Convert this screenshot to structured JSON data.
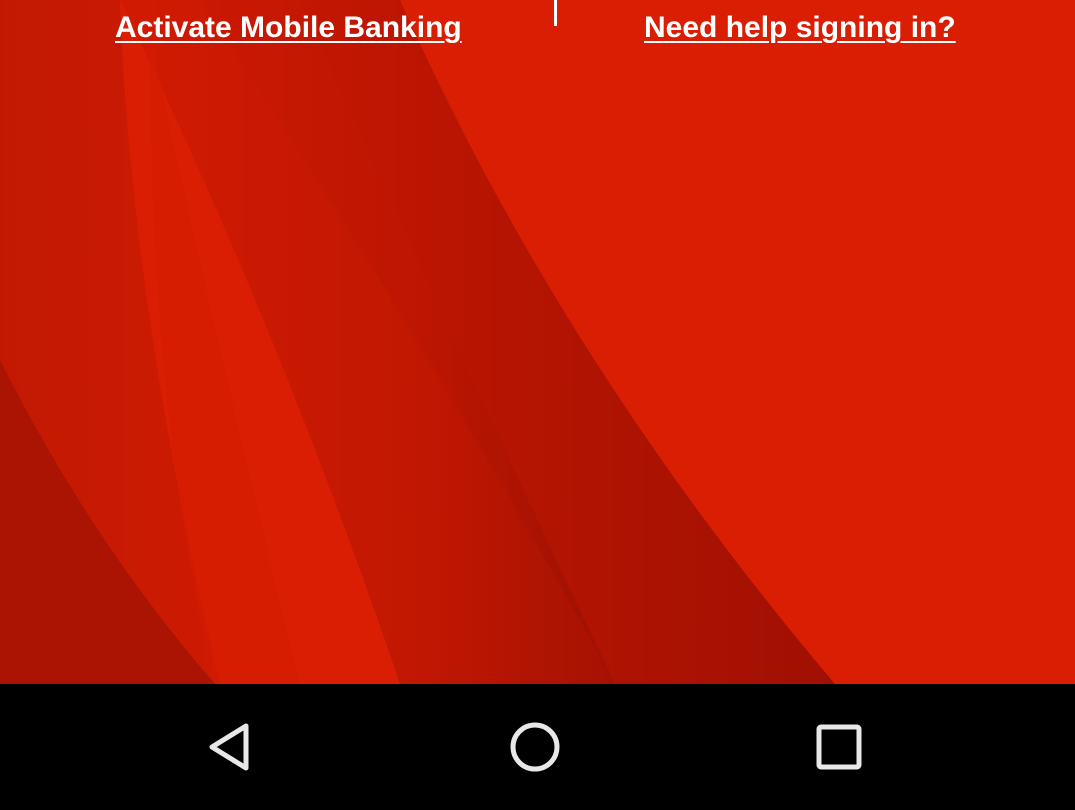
{
  "screen": {
    "links": {
      "activate_label": "Activate Mobile Banking",
      "help_label": "Need help signing in?"
    },
    "colors": {
      "background_red": "#d91e03",
      "dark_red": "#a81202",
      "link_text": "#ffffff",
      "nav_bar": "#000000"
    }
  },
  "nav_bar": {
    "icons": [
      "back-icon",
      "home-icon",
      "recents-icon"
    ]
  }
}
